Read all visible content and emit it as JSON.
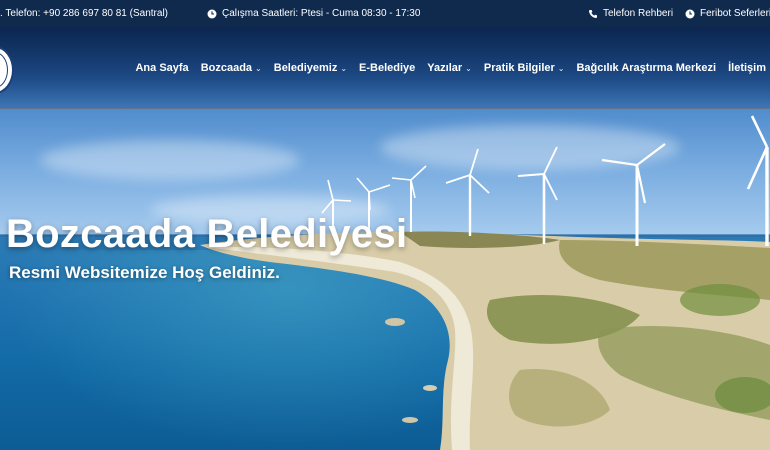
{
  "topbar": {
    "phone_text": ". Telefon: +90 286 697 80 81 (Santral)",
    "hours_text": "Çalışma Saatleri: Ptesi - Cuma 08:30 - 17:30",
    "phonebook_label": "Telefon Rehberi",
    "ferry_label": "Feribot Seferleri"
  },
  "nav": {
    "items": [
      {
        "label": "Ana Sayfa",
        "has_dropdown": false
      },
      {
        "label": "Bozcaada",
        "has_dropdown": true
      },
      {
        "label": "Belediyemiz",
        "has_dropdown": true
      },
      {
        "label": "E-Belediye",
        "has_dropdown": false
      },
      {
        "label": "Yazılar",
        "has_dropdown": true
      },
      {
        "label": "Pratik Bilgiler",
        "has_dropdown": true
      },
      {
        "label": "Bağcılık Araştırma Merkezi",
        "has_dropdown": false
      },
      {
        "label": "İletişim",
        "has_dropdown": false
      }
    ],
    "chevron": "⌄"
  },
  "hero": {
    "title": "Bozcaada Belediyesi",
    "subtitle": "Resmi Websitemize Hoş Geldiniz."
  },
  "colors": {
    "topbar_bg": "#0f2a4d",
    "nav_text": "#ffffff",
    "sky": "#3f7fc4",
    "sea": "#1f73b0"
  },
  "icons": {
    "hours": "clock-icon",
    "phonebook": "phone-icon",
    "ferry": "clock-icon"
  }
}
